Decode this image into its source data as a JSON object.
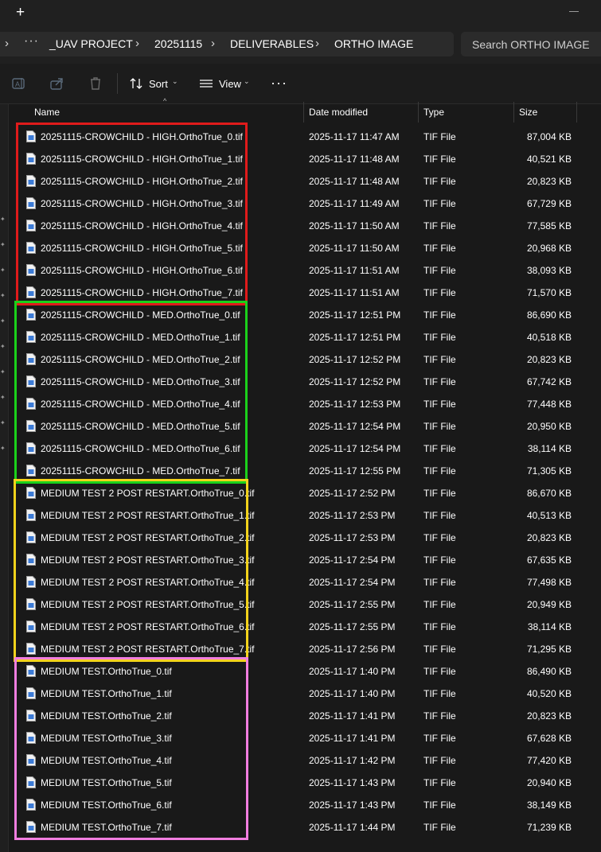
{
  "titlebar": {
    "new_tab_glyph": "+",
    "minimize_icon": "minimize-icon"
  },
  "address": {
    "overflow_glyph": "···",
    "crumbs": [
      "_UAV PROJECT",
      "20251115",
      "DELIVERABLES",
      "ORTHO IMAGE"
    ],
    "chevron": "›"
  },
  "search": {
    "placeholder": "Search ORTHO IMAGE"
  },
  "toolbar": {
    "icons": [
      "rename-icon",
      "share-icon",
      "delete-icon"
    ],
    "sort_label": "Sort",
    "view_label": "View",
    "more_glyph": "···",
    "caret": "⌄"
  },
  "columns": {
    "name": "Name",
    "date": "Date modified",
    "type": "Type",
    "size": "Size"
  },
  "files": [
    {
      "name": "20251115-CROWCHILD - HIGH.OrthoTrue_0.tif",
      "date": "2025-11-17 11:47 AM",
      "type": "TIF File",
      "size": "87,004 KB"
    },
    {
      "name": "20251115-CROWCHILD - HIGH.OrthoTrue_1.tif",
      "date": "2025-11-17 11:48 AM",
      "type": "TIF File",
      "size": "40,521 KB"
    },
    {
      "name": "20251115-CROWCHILD - HIGH.OrthoTrue_2.tif",
      "date": "2025-11-17 11:48 AM",
      "type": "TIF File",
      "size": "20,823 KB"
    },
    {
      "name": "20251115-CROWCHILD - HIGH.OrthoTrue_3.tif",
      "date": "2025-11-17 11:49 AM",
      "type": "TIF File",
      "size": "67,729 KB"
    },
    {
      "name": "20251115-CROWCHILD - HIGH.OrthoTrue_4.tif",
      "date": "2025-11-17 11:50 AM",
      "type": "TIF File",
      "size": "77,585 KB"
    },
    {
      "name": "20251115-CROWCHILD - HIGH.OrthoTrue_5.tif",
      "date": "2025-11-17 11:50 AM",
      "type": "TIF File",
      "size": "20,968 KB"
    },
    {
      "name": "20251115-CROWCHILD - HIGH.OrthoTrue_6.tif",
      "date": "2025-11-17 11:51 AM",
      "type": "TIF File",
      "size": "38,093 KB"
    },
    {
      "name": "20251115-CROWCHILD - HIGH.OrthoTrue_7.tif",
      "date": "2025-11-17 11:51 AM",
      "type": "TIF File",
      "size": "71,570 KB"
    },
    {
      "name": "20251115-CROWCHILD - MED.OrthoTrue_0.tif",
      "date": "2025-11-17 12:51 PM",
      "type": "TIF File",
      "size": "86,690 KB"
    },
    {
      "name": "20251115-CROWCHILD - MED.OrthoTrue_1.tif",
      "date": "2025-11-17 12:51 PM",
      "type": "TIF File",
      "size": "40,518 KB"
    },
    {
      "name": "20251115-CROWCHILD - MED.OrthoTrue_2.tif",
      "date": "2025-11-17 12:52 PM",
      "type": "TIF File",
      "size": "20,823 KB"
    },
    {
      "name": "20251115-CROWCHILD - MED.OrthoTrue_3.tif",
      "date": "2025-11-17 12:52 PM",
      "type": "TIF File",
      "size": "67,742 KB"
    },
    {
      "name": "20251115-CROWCHILD - MED.OrthoTrue_4.tif",
      "date": "2025-11-17 12:53 PM",
      "type": "TIF File",
      "size": "77,448 KB"
    },
    {
      "name": "20251115-CROWCHILD - MED.OrthoTrue_5.tif",
      "date": "2025-11-17 12:54 PM",
      "type": "TIF File",
      "size": "20,950 KB"
    },
    {
      "name": "20251115-CROWCHILD - MED.OrthoTrue_6.tif",
      "date": "2025-11-17 12:54 PM",
      "type": "TIF File",
      "size": "38,114 KB"
    },
    {
      "name": "20251115-CROWCHILD - MED.OrthoTrue_7.tif",
      "date": "2025-11-17 12:55 PM",
      "type": "TIF File",
      "size": "71,305 KB"
    },
    {
      "name": "MEDIUM TEST 2 POST RESTART.OrthoTrue_0.tif",
      "date": "2025-11-17 2:52 PM",
      "type": "TIF File",
      "size": "86,670 KB"
    },
    {
      "name": "MEDIUM TEST 2 POST RESTART.OrthoTrue_1.tif",
      "date": "2025-11-17 2:53 PM",
      "type": "TIF File",
      "size": "40,513 KB"
    },
    {
      "name": "MEDIUM TEST 2 POST RESTART.OrthoTrue_2.tif",
      "date": "2025-11-17 2:53 PM",
      "type": "TIF File",
      "size": "20,823 KB"
    },
    {
      "name": "MEDIUM TEST 2 POST RESTART.OrthoTrue_3.tif",
      "date": "2025-11-17 2:54 PM",
      "type": "TIF File",
      "size": "67,635 KB"
    },
    {
      "name": "MEDIUM TEST 2 POST RESTART.OrthoTrue_4.tif",
      "date": "2025-11-17 2:54 PM",
      "type": "TIF File",
      "size": "77,498 KB"
    },
    {
      "name": "MEDIUM TEST 2 POST RESTART.OrthoTrue_5.tif",
      "date": "2025-11-17 2:55 PM",
      "type": "TIF File",
      "size": "20,949 KB"
    },
    {
      "name": "MEDIUM TEST 2 POST RESTART.OrthoTrue_6.tif",
      "date": "2025-11-17 2:55 PM",
      "type": "TIF File",
      "size": "38,114 KB"
    },
    {
      "name": "MEDIUM TEST 2 POST RESTART.OrthoTrue_7.tif",
      "date": "2025-11-17 2:56 PM",
      "type": "TIF File",
      "size": "71,295 KB"
    },
    {
      "name": "MEDIUM TEST.OrthoTrue_0.tif",
      "date": "2025-11-17 1:40 PM",
      "type": "TIF File",
      "size": "86,490 KB"
    },
    {
      "name": "MEDIUM TEST.OrthoTrue_1.tif",
      "date": "2025-11-17 1:40 PM",
      "type": "TIF File",
      "size": "40,520 KB"
    },
    {
      "name": "MEDIUM TEST.OrthoTrue_2.tif",
      "date": "2025-11-17 1:41 PM",
      "type": "TIF File",
      "size": "20,823 KB"
    },
    {
      "name": "MEDIUM TEST.OrthoTrue_3.tif",
      "date": "2025-11-17 1:41 PM",
      "type": "TIF File",
      "size": "67,628 KB"
    },
    {
      "name": "MEDIUM TEST.OrthoTrue_4.tif",
      "date": "2025-11-17 1:42 PM",
      "type": "TIF File",
      "size": "77,420 KB"
    },
    {
      "name": "MEDIUM TEST.OrthoTrue_5.tif",
      "date": "2025-11-17 1:43 PM",
      "type": "TIF File",
      "size": "20,940 KB"
    },
    {
      "name": "MEDIUM TEST.OrthoTrue_6.tif",
      "date": "2025-11-17 1:43 PM",
      "type": "TIF File",
      "size": "38,149 KB"
    },
    {
      "name": "MEDIUM TEST.OrthoTrue_7.tif",
      "date": "2025-11-17 1:44 PM",
      "type": "TIF File",
      "size": "71,239 KB"
    }
  ],
  "highlight_groups": [
    {
      "color": "#e01b1b",
      "first_row": 0,
      "last_row": 7
    },
    {
      "color": "#1bd11b",
      "first_row": 8,
      "last_row": 15
    },
    {
      "color": "#f2d21b",
      "first_row": 16,
      "last_row": 23
    },
    {
      "color": "#f27ee0",
      "first_row": 24,
      "last_row": 31
    }
  ]
}
